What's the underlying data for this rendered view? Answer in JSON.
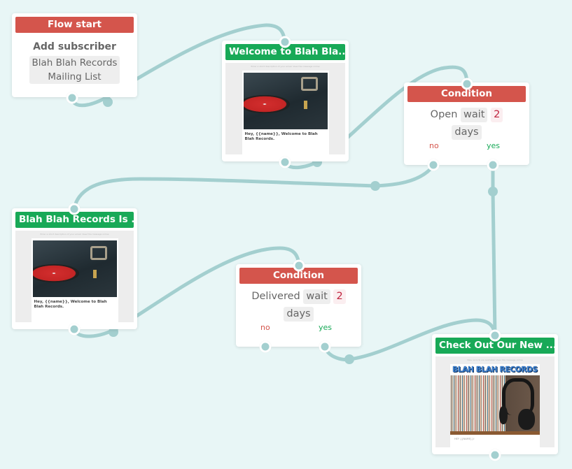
{
  "canvas": {
    "link_color": "#a3cfcf",
    "background": "#e8f6f6"
  },
  "nodes": {
    "flow_start": {
      "header": "Flow start",
      "header_color": "#d4554c",
      "title": "Add subscriber",
      "list_line1": "Blah Blah Records",
      "list_line2": "Mailing List"
    },
    "email_welcome": {
      "header": "Welcome to Blah Bla...",
      "header_color": "#18a957",
      "preview": {
        "preheader": "Enter a short description of your email. View this message online",
        "greeting": "Hey, {{name}}, Welcome to Blah Blah Records."
      }
    },
    "condition_open": {
      "header": "Condition",
      "header_color": "#d4554c",
      "event": "Open",
      "wait_label": "wait",
      "wait_value": "2",
      "unit": "days",
      "branch_no": "no",
      "branch_yes": "yes"
    },
    "email_is": {
      "header": "Blah Blah Records Is ...",
      "header_color": "#18a957",
      "preview": {
        "preheader": "Enter a short description of your email. View this message online",
        "greeting": "Hey, {{name}}, Welcome to Blah Blah Records."
      }
    },
    "condition_delivered": {
      "header": "Condition",
      "header_color": "#d4554c",
      "event": "Delivered",
      "wait_label": "wait",
      "wait_value": "2",
      "unit": "days",
      "branch_no": "no",
      "branch_yes": "yes"
    },
    "email_check_out": {
      "header": "Check Out Our New ...",
      "header_color": "#18a957",
      "preview": {
        "preheader": "New records are available! View this message online",
        "logo": "BLAH BLAH RECORDS",
        "footer": "HEY {{NAME}}!"
      }
    }
  }
}
